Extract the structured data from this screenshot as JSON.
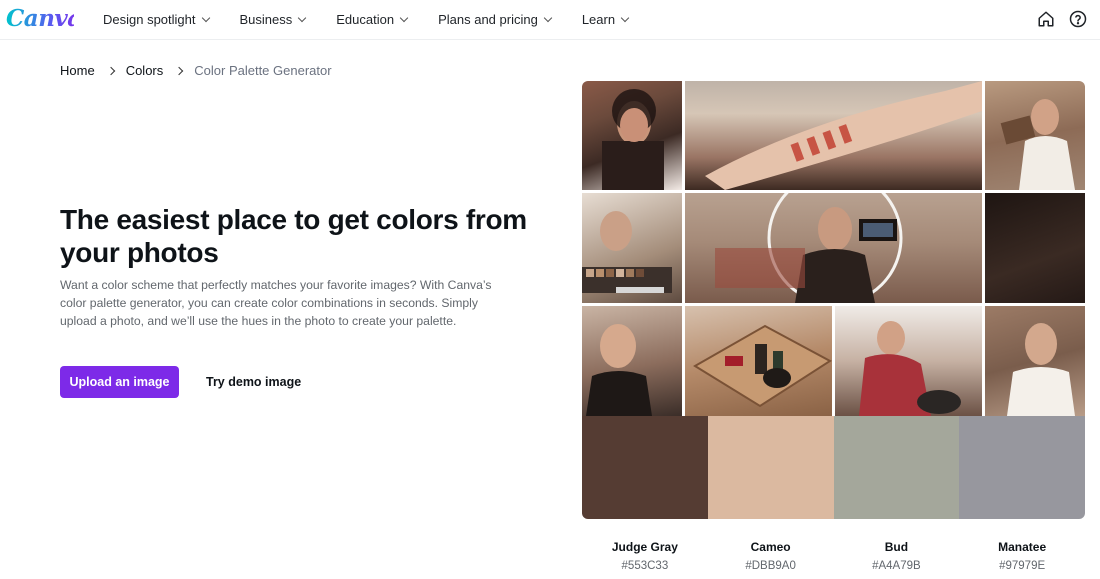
{
  "header": {
    "logo": "Canva",
    "nav": [
      {
        "label": "Design spotlight"
      },
      {
        "label": "Business"
      },
      {
        "label": "Education"
      },
      {
        "label": "Plans and pricing"
      },
      {
        "label": "Learn"
      }
    ],
    "icons": [
      "home-icon",
      "help-icon"
    ]
  },
  "breadcrumb": {
    "home": "Home",
    "colors": "Colors",
    "current": "Color Palette Generator"
  },
  "hero": {
    "title": "The easiest place to get colors from your photos",
    "description": "Want a color scheme that perfectly matches your favorite images? With Canva’s color palette generator, you can create color combinations in seconds. Simply upload a photo, and we’ll use the hues in the photo to create your palette.",
    "upload_label": "Upload an image",
    "demo_label": "Try demo image"
  },
  "palette": [
    {
      "name": "Judge Gray",
      "hex": "#553C33"
    },
    {
      "name": "Cameo",
      "hex": "#DBB9A0"
    },
    {
      "name": "Bud",
      "hex": "#A4A79B"
    },
    {
      "name": "Manatee",
      "hex": "#97979E"
    }
  ],
  "colors": {
    "accent": "#7D2AE8",
    "logo_start": "#00C4CC",
    "logo_end": "#7D2AE8"
  }
}
